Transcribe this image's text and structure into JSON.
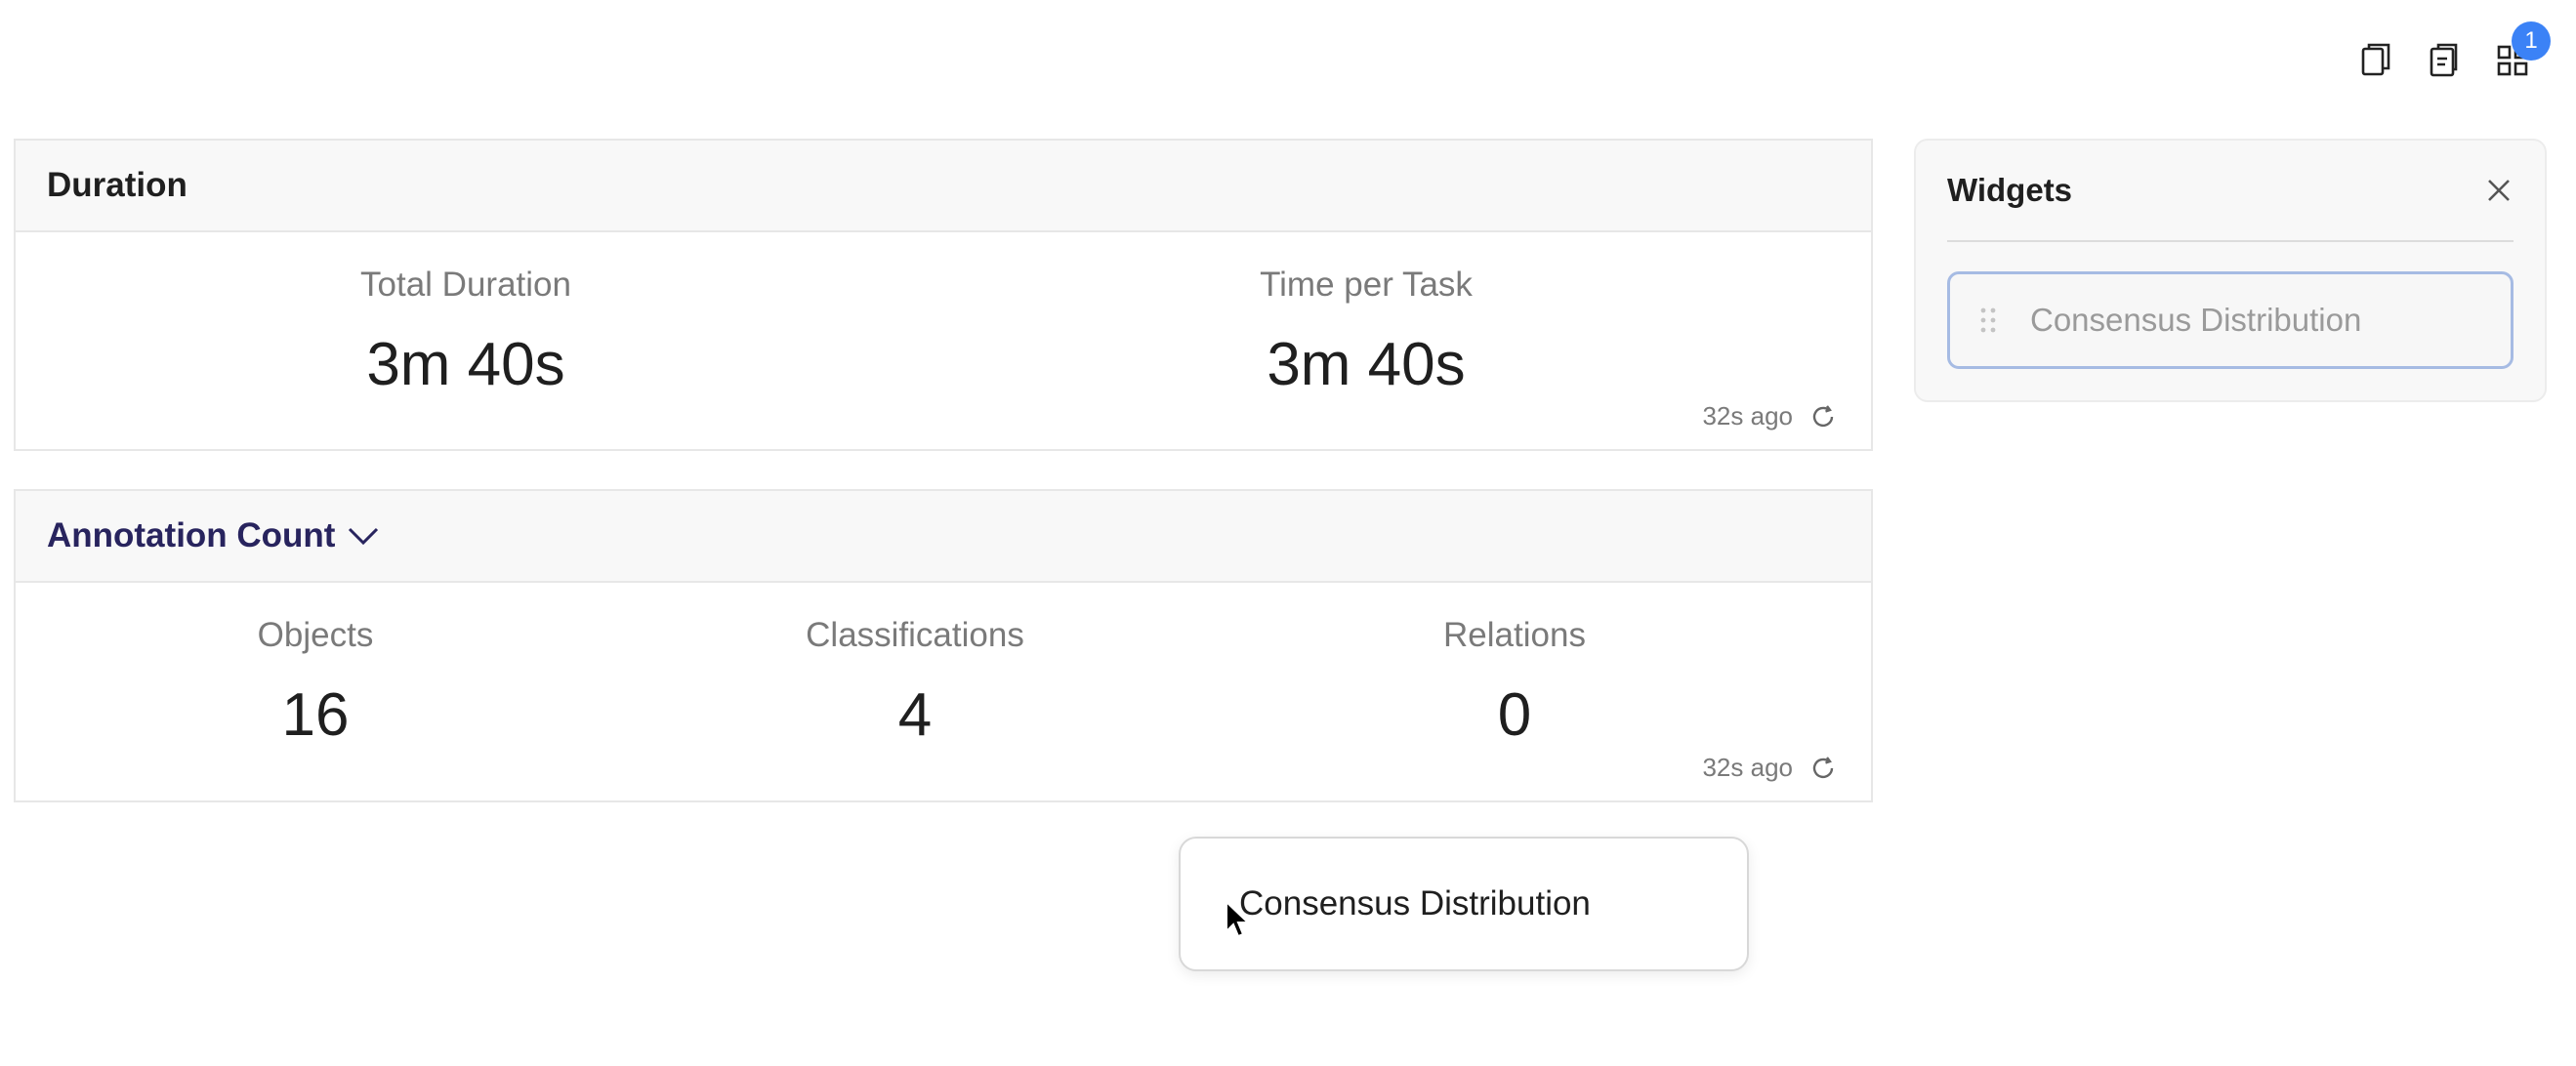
{
  "toolbar": {
    "buttons": [
      {
        "icon": "copy-icon"
      },
      {
        "icon": "paste-icon"
      },
      {
        "icon": "widgets-grid-icon",
        "badge": "1"
      }
    ]
  },
  "duration_card": {
    "title": "Duration",
    "metrics": [
      {
        "label": "Total Duration",
        "value": "3m 40s"
      },
      {
        "label": "Time per Task",
        "value": "3m 40s"
      }
    ],
    "updated": "32s ago"
  },
  "annotation_card": {
    "title": "Annotation Count",
    "metrics": [
      {
        "label": "Objects",
        "value": "16"
      },
      {
        "label": "Classifications",
        "value": "4"
      },
      {
        "label": "Relations",
        "value": "0"
      }
    ],
    "updated": "32s ago"
  },
  "widgets_panel": {
    "title": "Widgets",
    "items": [
      {
        "label": "Consensus Distribution"
      }
    ]
  },
  "drag_preview": {
    "label": "Consensus Distribution"
  },
  "colors": {
    "accent": "#3b82f6",
    "title_link": "#28245e",
    "widget_border": "#a6bbe3"
  }
}
